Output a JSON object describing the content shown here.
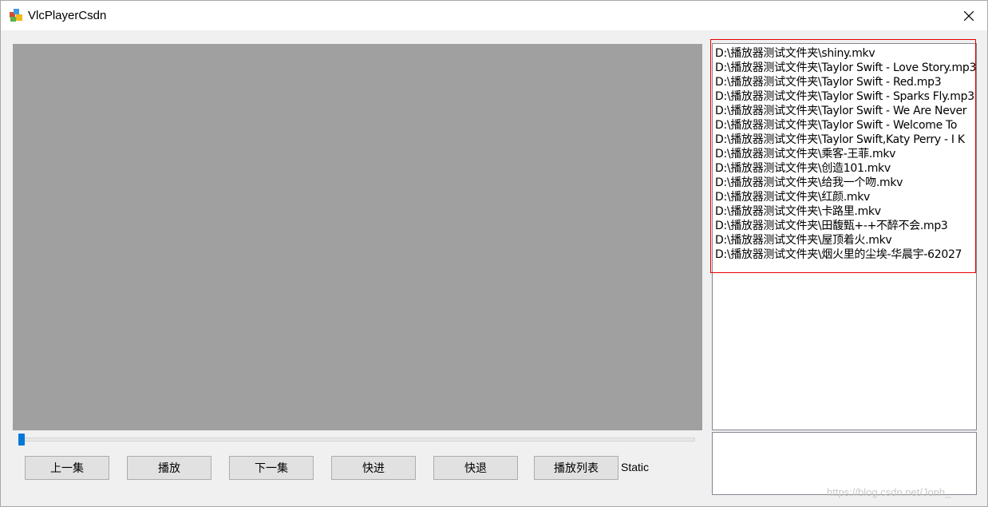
{
  "window": {
    "title": "VlcPlayerCsdn"
  },
  "icons": {
    "app": "vlc-app-icon",
    "close": "close-icon"
  },
  "seek": {
    "progress": 0.0
  },
  "controls": {
    "prev_label": "上一集",
    "play_label": "播放",
    "next_label": "下一集",
    "forward_label": "快进",
    "rewind_label": "快退",
    "playlist_label": "播放列表",
    "static_text": "Static"
  },
  "playlist": {
    "items": [
      "D:\\播放器测试文件夹\\shiny.mkv",
      "D:\\播放器测试文件夹\\Taylor Swift - Love Story.mp3",
      "D:\\播放器测试文件夹\\Taylor Swift - Red.mp3",
      "D:\\播放器测试文件夹\\Taylor Swift - Sparks Fly.mp3",
      "D:\\播放器测试文件夹\\Taylor Swift - We Are Never",
      "D:\\播放器测试文件夹\\Taylor Swift - Welcome To",
      "D:\\播放器测试文件夹\\Taylor Swift,Katy Perry - I K",
      "D:\\播放器测试文件夹\\乘客-王菲.mkv",
      "D:\\播放器测试文件夹\\创造101.mkv",
      "D:\\播放器测试文件夹\\给我一个吻.mkv",
      "D:\\播放器测试文件夹\\红颜.mkv",
      "D:\\播放器测试文件夹\\卡路里.mkv",
      "D:\\播放器测试文件夹\\田馥甄+-+不醉不会.mp3",
      "D:\\播放器测试文件夹\\屋顶着火.mkv",
      "D:\\播放器测试文件夹\\烟火里的尘埃-华晨宇-62027"
    ]
  },
  "watermark": "https://blog.csdn.net/Jonh_",
  "colors": {
    "video_bg": "#a0a0a0",
    "seek_thumb": "#0078d7",
    "highlight": "#e60000"
  }
}
